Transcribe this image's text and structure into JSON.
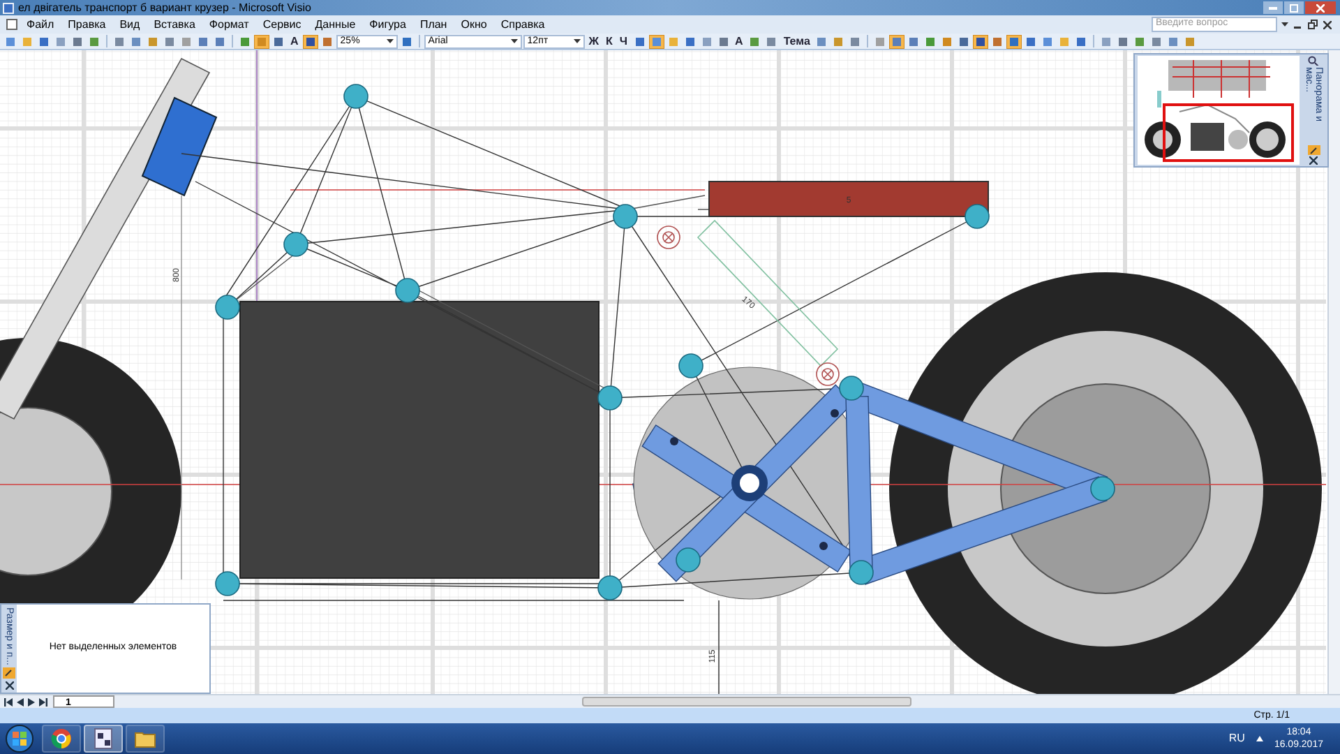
{
  "window": {
    "title": "ел двігатель транспорт б вариант крузер - Microsoft Visio"
  },
  "menu": [
    "Файл",
    "Правка",
    "Вид",
    "Вставка",
    "Формат",
    "Сервис",
    "Данные",
    "Фигура",
    "План",
    "Окно",
    "Справка"
  ],
  "help_search": {
    "placeholder": "Введите вопрос"
  },
  "toolbar": [
    {
      "kind": "icon",
      "active": false
    },
    {
      "kind": "icon",
      "active": false
    },
    {
      "kind": "icon",
      "active": false
    },
    {
      "kind": "icon",
      "active": false
    },
    {
      "kind": "icon",
      "active": false
    },
    {
      "kind": "icon",
      "active": false
    },
    {
      "kind": "sep"
    },
    {
      "kind": "icon",
      "active": false
    },
    {
      "kind": "icon",
      "active": false
    },
    {
      "kind": "icon",
      "active": false
    },
    {
      "kind": "icon",
      "active": false
    },
    {
      "kind": "icon",
      "active": false
    },
    {
      "kind": "icon",
      "active": false
    },
    {
      "kind": "icon",
      "active": false
    },
    {
      "kind": "sep"
    },
    {
      "kind": "icon",
      "active": false
    },
    {
      "kind": "icon",
      "active": true
    },
    {
      "kind": "icon",
      "active": false
    },
    {
      "kind": "glyph",
      "label": "A",
      "active": false
    },
    {
      "kind": "icon",
      "active": true
    },
    {
      "kind": "icon",
      "active": false
    },
    {
      "kind": "dropdown",
      "value": "25%"
    },
    {
      "kind": "icon",
      "active": false
    },
    {
      "kind": "sep"
    },
    {
      "kind": "wide-dropdown",
      "value": "Arial"
    },
    {
      "kind": "dropdown",
      "value": "12пт"
    },
    {
      "kind": "glyph",
      "label": "Ж",
      "active": false
    },
    {
      "kind": "glyph",
      "label": "К",
      "active": false
    },
    {
      "kind": "glyph",
      "label": "Ч",
      "active": false
    },
    {
      "kind": "icon",
      "active": false
    },
    {
      "kind": "icon",
      "active": true
    },
    {
      "kind": "icon",
      "active": false
    },
    {
      "kind": "icon",
      "active": false
    },
    {
      "kind": "icon",
      "active": false
    },
    {
      "kind": "icon",
      "active": false
    },
    {
      "kind": "glyph",
      "label": "A",
      "active": false
    },
    {
      "kind": "icon",
      "active": false
    },
    {
      "kind": "icon",
      "active": false
    },
    {
      "kind": "glyph",
      "label": "Тема",
      "active": false
    },
    {
      "kind": "icon",
      "active": false
    },
    {
      "kind": "icon",
      "active": false
    },
    {
      "kind": "icon",
      "active": false
    },
    {
      "kind": "sep"
    },
    {
      "kind": "icon",
      "active": false
    },
    {
      "kind": "icon",
      "active": true
    },
    {
      "kind": "icon",
      "active": false
    },
    {
      "kind": "icon",
      "active": false
    },
    {
      "kind": "icon",
      "active": false
    },
    {
      "kind": "icon",
      "active": false
    },
    {
      "kind": "icon",
      "active": true
    },
    {
      "kind": "icon",
      "active": false
    },
    {
      "kind": "icon",
      "active": true
    },
    {
      "kind": "icon",
      "active": false
    },
    {
      "kind": "icon",
      "active": false
    },
    {
      "kind": "icon",
      "active": false
    },
    {
      "kind": "icon",
      "active": false
    },
    {
      "kind": "sep"
    },
    {
      "kind": "icon",
      "active": false
    },
    {
      "kind": "icon",
      "active": false
    },
    {
      "kind": "icon",
      "active": false
    },
    {
      "kind": "icon",
      "active": false
    },
    {
      "kind": "icon",
      "active": false
    },
    {
      "kind": "icon",
      "active": false
    }
  ],
  "drawing": {
    "bar_label": "5",
    "height_label": "800",
    "rod_label": "170",
    "bottom_label": "115"
  },
  "pan_zoom": {
    "title": "Панорама и мас..."
  },
  "size_window": {
    "title": "Размер и п...",
    "message": "Нет выделенных элементов"
  },
  "page_tabs": [
    {
      "label": "1",
      "selected": true
    }
  ],
  "status_bar": {
    "page": "Стр. 1/1"
  },
  "taskbar": {
    "apps": [
      {
        "kind": "browser",
        "selected": false
      },
      {
        "kind": "visio",
        "selected": true
      },
      {
        "kind": "folder",
        "selected": false
      }
    ],
    "language": "RU",
    "time": "18:04",
    "date": "16.09.2017"
  }
}
